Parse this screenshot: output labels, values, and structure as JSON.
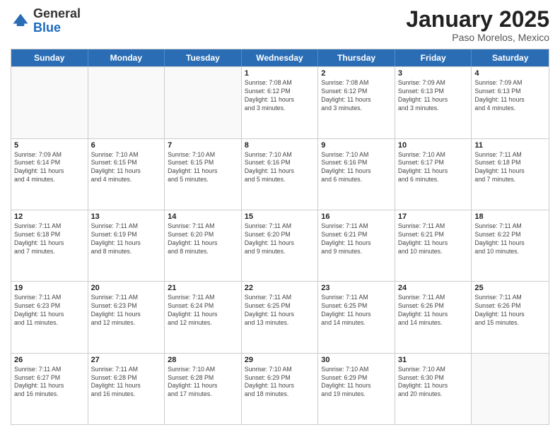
{
  "header": {
    "logo_general": "General",
    "logo_blue": "Blue",
    "title": "January 2025",
    "location": "Paso Morelos, Mexico"
  },
  "weekdays": [
    "Sunday",
    "Monday",
    "Tuesday",
    "Wednesday",
    "Thursday",
    "Friday",
    "Saturday"
  ],
  "rows": [
    [
      {
        "day": "",
        "info": ""
      },
      {
        "day": "",
        "info": ""
      },
      {
        "day": "",
        "info": ""
      },
      {
        "day": "1",
        "info": "Sunrise: 7:08 AM\nSunset: 6:12 PM\nDaylight: 11 hours\nand 3 minutes."
      },
      {
        "day": "2",
        "info": "Sunrise: 7:08 AM\nSunset: 6:12 PM\nDaylight: 11 hours\nand 3 minutes."
      },
      {
        "day": "3",
        "info": "Sunrise: 7:09 AM\nSunset: 6:13 PM\nDaylight: 11 hours\nand 3 minutes."
      },
      {
        "day": "4",
        "info": "Sunrise: 7:09 AM\nSunset: 6:13 PM\nDaylight: 11 hours\nand 4 minutes."
      }
    ],
    [
      {
        "day": "5",
        "info": "Sunrise: 7:09 AM\nSunset: 6:14 PM\nDaylight: 11 hours\nand 4 minutes."
      },
      {
        "day": "6",
        "info": "Sunrise: 7:10 AM\nSunset: 6:15 PM\nDaylight: 11 hours\nand 4 minutes."
      },
      {
        "day": "7",
        "info": "Sunrise: 7:10 AM\nSunset: 6:15 PM\nDaylight: 11 hours\nand 5 minutes."
      },
      {
        "day": "8",
        "info": "Sunrise: 7:10 AM\nSunset: 6:16 PM\nDaylight: 11 hours\nand 5 minutes."
      },
      {
        "day": "9",
        "info": "Sunrise: 7:10 AM\nSunset: 6:16 PM\nDaylight: 11 hours\nand 6 minutes."
      },
      {
        "day": "10",
        "info": "Sunrise: 7:10 AM\nSunset: 6:17 PM\nDaylight: 11 hours\nand 6 minutes."
      },
      {
        "day": "11",
        "info": "Sunrise: 7:11 AM\nSunset: 6:18 PM\nDaylight: 11 hours\nand 7 minutes."
      }
    ],
    [
      {
        "day": "12",
        "info": "Sunrise: 7:11 AM\nSunset: 6:18 PM\nDaylight: 11 hours\nand 7 minutes."
      },
      {
        "day": "13",
        "info": "Sunrise: 7:11 AM\nSunset: 6:19 PM\nDaylight: 11 hours\nand 8 minutes."
      },
      {
        "day": "14",
        "info": "Sunrise: 7:11 AM\nSunset: 6:20 PM\nDaylight: 11 hours\nand 8 minutes."
      },
      {
        "day": "15",
        "info": "Sunrise: 7:11 AM\nSunset: 6:20 PM\nDaylight: 11 hours\nand 9 minutes."
      },
      {
        "day": "16",
        "info": "Sunrise: 7:11 AM\nSunset: 6:21 PM\nDaylight: 11 hours\nand 9 minutes."
      },
      {
        "day": "17",
        "info": "Sunrise: 7:11 AM\nSunset: 6:21 PM\nDaylight: 11 hours\nand 10 minutes."
      },
      {
        "day": "18",
        "info": "Sunrise: 7:11 AM\nSunset: 6:22 PM\nDaylight: 11 hours\nand 10 minutes."
      }
    ],
    [
      {
        "day": "19",
        "info": "Sunrise: 7:11 AM\nSunset: 6:23 PM\nDaylight: 11 hours\nand 11 minutes."
      },
      {
        "day": "20",
        "info": "Sunrise: 7:11 AM\nSunset: 6:23 PM\nDaylight: 11 hours\nand 12 minutes."
      },
      {
        "day": "21",
        "info": "Sunrise: 7:11 AM\nSunset: 6:24 PM\nDaylight: 11 hours\nand 12 minutes."
      },
      {
        "day": "22",
        "info": "Sunrise: 7:11 AM\nSunset: 6:25 PM\nDaylight: 11 hours\nand 13 minutes."
      },
      {
        "day": "23",
        "info": "Sunrise: 7:11 AM\nSunset: 6:25 PM\nDaylight: 11 hours\nand 14 minutes."
      },
      {
        "day": "24",
        "info": "Sunrise: 7:11 AM\nSunset: 6:26 PM\nDaylight: 11 hours\nand 14 minutes."
      },
      {
        "day": "25",
        "info": "Sunrise: 7:11 AM\nSunset: 6:26 PM\nDaylight: 11 hours\nand 15 minutes."
      }
    ],
    [
      {
        "day": "26",
        "info": "Sunrise: 7:11 AM\nSunset: 6:27 PM\nDaylight: 11 hours\nand 16 minutes."
      },
      {
        "day": "27",
        "info": "Sunrise: 7:11 AM\nSunset: 6:28 PM\nDaylight: 11 hours\nand 16 minutes."
      },
      {
        "day": "28",
        "info": "Sunrise: 7:10 AM\nSunset: 6:28 PM\nDaylight: 11 hours\nand 17 minutes."
      },
      {
        "day": "29",
        "info": "Sunrise: 7:10 AM\nSunset: 6:29 PM\nDaylight: 11 hours\nand 18 minutes."
      },
      {
        "day": "30",
        "info": "Sunrise: 7:10 AM\nSunset: 6:29 PM\nDaylight: 11 hours\nand 19 minutes."
      },
      {
        "day": "31",
        "info": "Sunrise: 7:10 AM\nSunset: 6:30 PM\nDaylight: 11 hours\nand 20 minutes."
      },
      {
        "day": "",
        "info": ""
      }
    ]
  ]
}
